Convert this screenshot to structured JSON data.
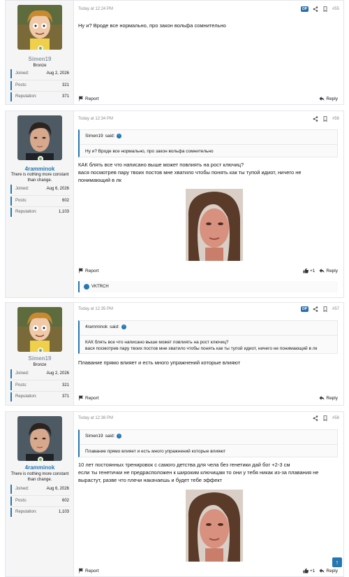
{
  "colors": {
    "accent": "#2577b1",
    "online": "#63b449",
    "op_badge": "#2a6fad"
  },
  "labels": {
    "joined": "Joined:",
    "posts": "Posts:",
    "reputation": "Reputation:",
    "report": "Report",
    "reply": "Reply",
    "op": "OP",
    "said": "said:"
  },
  "users": {
    "simen": {
      "name": "Simen19",
      "title": "Bronze",
      "joined": "Aug 2, 2026",
      "posts": "321",
      "reputation": "371"
    },
    "ramm": {
      "name": "4ramminok",
      "title": "There is nothing more constant than change.",
      "joined": "Aug 6, 2026",
      "posts": "602",
      "reputation": "1,103"
    }
  },
  "posts": [
    {
      "time": "Today at 12:24 PM",
      "number": "#55",
      "text": "Ну и? Вроде все нормально, про закон вольфа сомнительно"
    },
    {
      "time": "Today at 12:34 PM",
      "number": "#56",
      "quote_author": "Simen19",
      "quote_text": "Ну и? Вроде все нормально, про закон вольфа сомнительно",
      "text_line1": "КАК блять все что написано выше может повлиять на рост ключиц?",
      "text_line2": "вася посмотрев пару твоих постов мне хватило чтобы понять как ты тупой идиот, ничего не",
      "text_line3": "понимающий в лк",
      "likes": "+1",
      "reactor": "VKTRCH"
    },
    {
      "time": "Today at 12:35 PM",
      "number": "#57",
      "quote_author": "4ramminok",
      "quote_line1": "КАК блять все что написано выше может повлиять на рост ключиц?",
      "quote_line2": "вася посмотрев пару твоих постов мне хватило чтобы понять как ты тупой идиот, ничего не понимающий в лк",
      "text": "Плавание прямо влияет и есть много упражнений которые влияют"
    },
    {
      "time": "Today at 12:38 PM",
      "number": "#58",
      "quote_author": "Simen19",
      "quote_text": "Плавание прямо влияет и есть много упражнений которые влияют",
      "text_line1": "10 лет постоянных тренировок с самого детства для чела без генетики дай бог +2-3 см",
      "text_line2": "если ты генетички не предрасположен к широким ключицам то они у тебя никак из-за плавания не",
      "text_line3": "вырастут, разве что плечи накачаешь и будет тебе эффект",
      "likes": "+1"
    }
  ]
}
